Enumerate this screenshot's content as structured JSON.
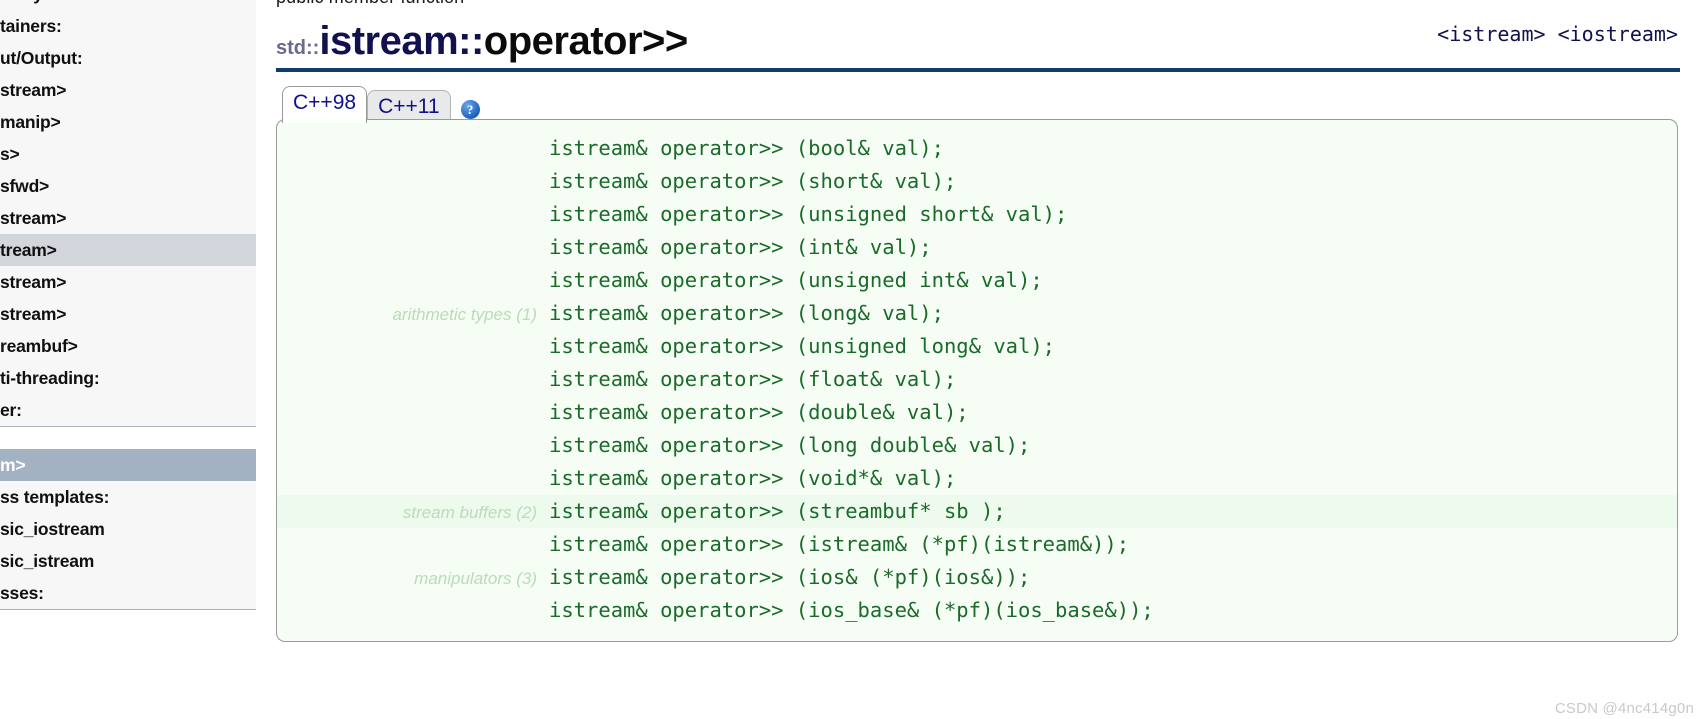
{
  "sidebar": {
    "accent_bar_color": "#a9b6c4",
    "selected_gray_color": "#d2d6dc",
    "selected_blue_color": "#a3b2c2",
    "group_one": [
      {
        "label": "Reference library:",
        "clipped_label": "brary:",
        "selected": false
      },
      {
        "label": "Containers:",
        "clipped_label": "tainers:",
        "selected": false
      },
      {
        "label": "Input/Output:",
        "clipped_label": "ut/Output:",
        "selected": false
      },
      {
        "label": "<fstream>",
        "clipped_label": "stream>",
        "selected": false
      },
      {
        "label": "<iomanip>",
        "clipped_label": "manip>",
        "selected": false
      },
      {
        "label": "<ios>",
        "clipped_label": "s>",
        "selected": false
      },
      {
        "label": "<iosfwd>",
        "clipped_label": "sfwd>",
        "selected": false
      },
      {
        "label": "<iostream>",
        "clipped_label": "stream>",
        "selected": false
      },
      {
        "label": "<istream>",
        "clipped_label": "tream>",
        "selected": true
      },
      {
        "label": "<ostream>",
        "clipped_label": "stream>",
        "selected": false
      },
      {
        "label": "<sstream>",
        "clipped_label": "stream>",
        "selected": false
      },
      {
        "label": "<streambuf>",
        "clipped_label": "reambuf>",
        "selected": false
      },
      {
        "label": "Multi-threading:",
        "clipped_label": "ti-threading:",
        "selected": false
      },
      {
        "label": "Other:",
        "clipped_label": "er:",
        "selected": false
      }
    ],
    "group_two": [
      {
        "label": "<istream>",
        "clipped_label": "m>",
        "selected": true
      },
      {
        "label": "class templates:",
        "clipped_label": "ss templates:",
        "selected": false
      },
      {
        "label": "basic_iostream",
        "clipped_label": "sic_iostream",
        "selected": false
      },
      {
        "label": "basic_istream",
        "clipped_label": "sic_istream",
        "selected": false
      },
      {
        "label": "classes:",
        "clipped_label": "sses:",
        "selected": false
      }
    ]
  },
  "content": {
    "eyebrow": "public member function",
    "title": {
      "namespace": "std::",
      "class_name": "istream::",
      "member": "operator>>"
    },
    "headers": "<istream> <iostream>",
    "rule_color": "#123a6b",
    "tabs": [
      {
        "label": "C++98",
        "active": true
      },
      {
        "label": "C++11",
        "active": false
      }
    ],
    "help_icon_label": "?",
    "code_rows": [
      {
        "label": "",
        "code": "istream& operator>> (bool& val);",
        "highlight": false
      },
      {
        "label": "",
        "code": "istream& operator>> (short& val);",
        "highlight": false
      },
      {
        "label": "",
        "code": "istream& operator>> (unsigned short& val);",
        "highlight": false
      },
      {
        "label": "",
        "code": "istream& operator>> (int& val);",
        "highlight": false
      },
      {
        "label": "",
        "code": "istream& operator>> (unsigned int& val);",
        "highlight": false
      },
      {
        "label": "arithmetic types (1)",
        "code": "istream& operator>> (long& val);",
        "highlight": false
      },
      {
        "label": "",
        "code": "istream& operator>> (unsigned long& val);",
        "highlight": false
      },
      {
        "label": "",
        "code": "istream& operator>> (float& val);",
        "highlight": false
      },
      {
        "label": "",
        "code": "istream& operator>> (double& val);",
        "highlight": false
      },
      {
        "label": "",
        "code": "istream& operator>> (long double& val);",
        "highlight": false
      },
      {
        "label": "",
        "code": "istream& operator>> (void*& val);",
        "highlight": false
      },
      {
        "label": "stream buffers (2)",
        "code": "istream& operator>> (streambuf* sb );",
        "highlight": true
      },
      {
        "label": "",
        "code": "istream& operator>> (istream& (*pf)(istream&));",
        "highlight": false
      },
      {
        "label": "manipulators (3)",
        "code": "istream& operator>> (ios& (*pf)(ios&));",
        "highlight": false
      },
      {
        "label": "",
        "code": "istream& operator>> (ios_base& (*pf)(ios_base&));",
        "highlight": false
      }
    ]
  },
  "watermark": "CSDN @4nc414g0n"
}
